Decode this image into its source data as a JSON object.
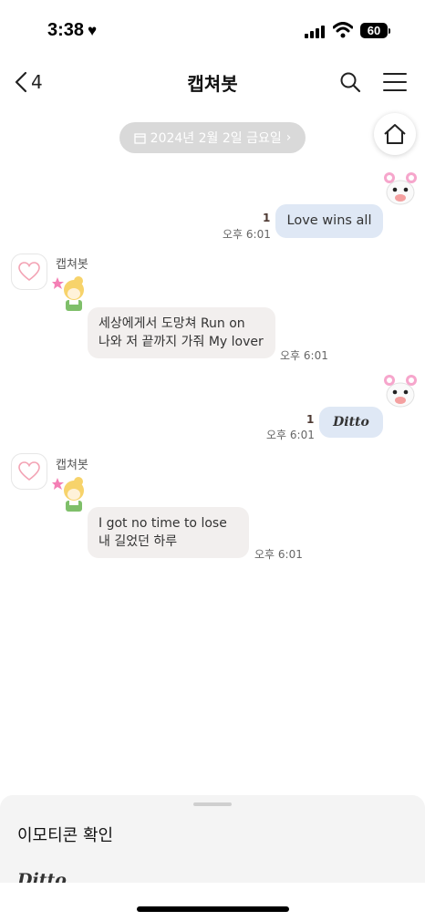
{
  "status_bar": {
    "time": "3:38",
    "battery": "60"
  },
  "header": {
    "back_count": "4",
    "title": "캡쳐봇"
  },
  "date_chip": {
    "label": "2024년 2월 2일 금요일",
    "chevron": "›"
  },
  "messages": [
    {
      "direction": "out",
      "text": "Love wins all",
      "read_count": "1",
      "time": "오후 6:01"
    },
    {
      "direction": "in",
      "sender": "캡쳐봇",
      "line1": "세상에게서 도망쳐 Run on",
      "line2": "나와 저 끝까지 가줘 My lover",
      "time": "오후 6:01"
    },
    {
      "direction": "out",
      "text": "Ditto",
      "read_count": "1",
      "time": "오후 6:01"
    },
    {
      "direction": "in",
      "sender": "캡쳐봇",
      "line1": "I got no time to lose",
      "line2": "내 길었던 하루",
      "time": "오후 6:01"
    }
  ],
  "bottom_sheet": {
    "title": "이모티콘 확인",
    "preview": "Ditto"
  },
  "icons": [
    "heart-icon",
    "signal-icon",
    "wifi-icon",
    "battery-icon",
    "back-chevron-icon",
    "search-icon",
    "menu-icon",
    "calendar-icon",
    "home-icon",
    "heart-profile-icon",
    "sticker-icon"
  ],
  "colors": {
    "outgoing_bubble": "#dfe8f5",
    "incoming_bubble": "#f2efee",
    "read_count": "#4e3a33",
    "date_chip": "#d9d9d9"
  }
}
